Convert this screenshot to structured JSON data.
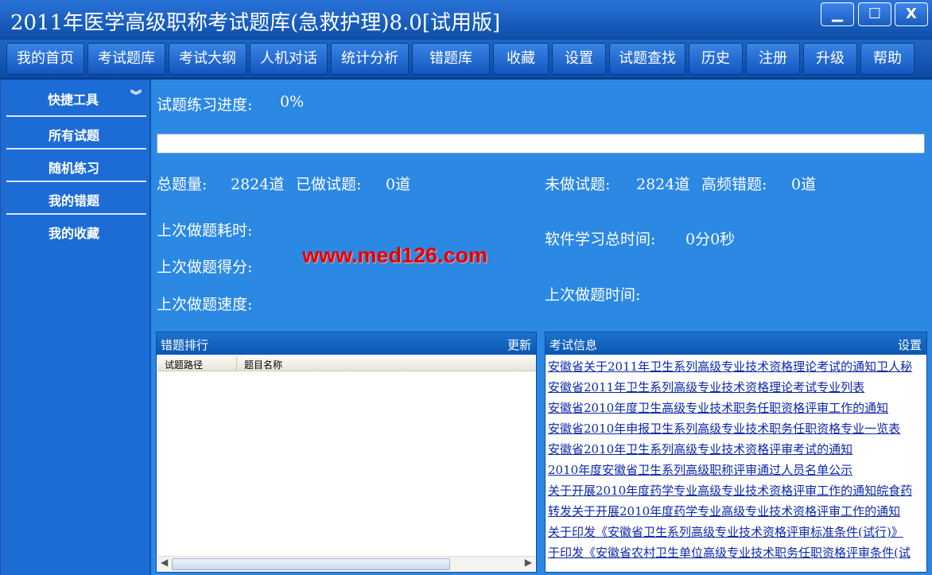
{
  "app": {
    "title": "2011年医学高级职称考试题库(急救护理)8.0[试用版]"
  },
  "window_controls": {
    "minimize": "▁",
    "maximize": "☐",
    "close": "X"
  },
  "toolbar": {
    "items": [
      "我的首页",
      "考试题库",
      "考试大纲",
      "人机对话",
      "统计分析",
      "错题库",
      "收藏",
      "设置",
      "试题查找",
      "历史",
      "注册",
      "升级",
      "帮助"
    ]
  },
  "sidebar": {
    "header": "快捷工具",
    "items": [
      "所有试题",
      "随机练习",
      "我的错题",
      "我的收藏"
    ]
  },
  "stats": {
    "progress_label": "试题练习进度:",
    "progress_value": "0%",
    "progress_fraction": 0,
    "total_label": "总题量:",
    "total_value": "2824道",
    "done_label": "已做试题:",
    "done_value": "0道",
    "undone_label": "未做试题:",
    "undone_value": "2824道",
    "frequent_wrong_label": "高频错题:",
    "frequent_wrong_value": "0道",
    "last_time_used_label": "上次做题耗时:",
    "last_score_label": "上次做题得分:",
    "last_speed_label": "上次做题速度:",
    "total_study_label": "软件学习总时间:",
    "total_study_value": "0分0秒",
    "last_time_label": "上次做题时间:"
  },
  "watermark": "www.med126.com",
  "wrong_rank": {
    "title": "错题排行",
    "action": "更新",
    "columns": [
      "试题路径",
      "题目名称"
    ]
  },
  "exam_info": {
    "title": "考试信息",
    "action": "设置",
    "links": [
      "安徽省关于2011年卫生系列高级专业技术资格理论考试的通知卫人秘",
      "安徽省2011年卫生系列高级专业技术资格理论考试专业列表",
      "安徽省2010年度卫生高级专业技术职务任职资格评审工作的通知",
      "安徽省2010年申报卫生系列高级专业技术职务任职资格专业一览表",
      "安徽省2010年卫生系列高级专业技术资格评审考试的通知",
      "2010年度安徽省卫生系列高级职称评审通过人员名单公示",
      "关于开展2010年度药学专业高级专业技术资格评审工作的通知皖食药",
      "转发关于开展2010年度药学专业高级专业技术资格评审工作的通知",
      "关于印发《安徽省卫生系列高级专业技术资格评审标准条件(试行)》",
      "于印发《安徽省农村卫生单位高级专业技术职务任职资格评审条件(试"
    ]
  }
}
